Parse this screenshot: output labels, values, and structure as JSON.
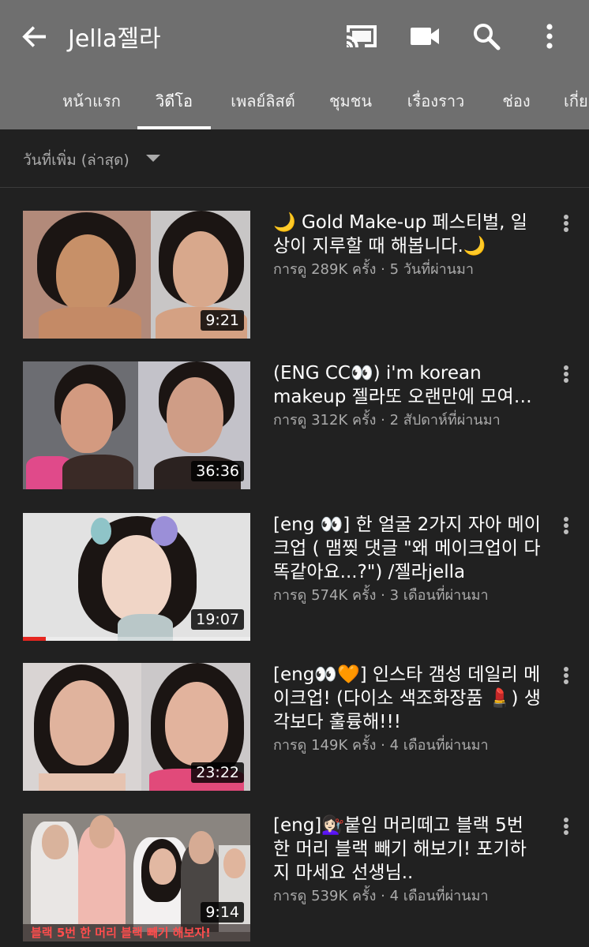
{
  "header": {
    "title": "Jella젤라",
    "icons": [
      "back-arrow-icon",
      "cast-icon",
      "video-camera-icon",
      "search-icon",
      "more-vert-icon"
    ]
  },
  "tabs": [
    {
      "label": "หน้าแรก",
      "active": false
    },
    {
      "label": "วิดีโอ",
      "active": true
    },
    {
      "label": "เพลย์ลิสต์",
      "active": false
    },
    {
      "label": "ชุมชน",
      "active": false
    },
    {
      "label": "เรื่องราว",
      "active": false
    },
    {
      "label": "ช่อง",
      "active": false
    },
    {
      "label": "เกี่ย",
      "active": false
    }
  ],
  "sort": {
    "label": "วันที่เพิ่ม (ล่าสุด)"
  },
  "videos": [
    {
      "title": "🌙 Gold Make-up 페스티벌, 일상이 지루할 때 해봅니다.🌙",
      "views": "การดู 289K ครั้ง",
      "age": "5 วันที่ผ่านมา",
      "subtitle": "การดู 289K ครั้ง · 5 วันที่ผ่านมา",
      "duration": "9:21"
    },
    {
      "title": "(ENG CC👀) i'm korean makeup 젤라또 오랜만에 모여…",
      "views": "การดู 312K ครั้ง",
      "age": "2 สัปดาห์ที่ผ่านมา",
      "subtitle": "การดู 312K ครั้ง · 2 สัปดาห์ที่ผ่านมา",
      "duration": "36:36"
    },
    {
      "title": "[eng 👀] 한 얼굴 2가지 자아 메이크업 ( 맴찢 댓글 \"왜 메이크업이 다 똑같아요...?\") /젤라jella",
      "views": "การดู 574K ครั้ง",
      "age": "3 เดือนที่ผ่านมา",
      "subtitle": "การดู 574K ครั้ง · 3 เดือนที่ผ่านมา",
      "duration": "19:07",
      "watched_fraction": 0.1
    },
    {
      "title": "[eng👀🧡] 인스타 갬성 데일리 메이크업! (다이소 색조화장품 💄) 생각보다 훌륭해!!!",
      "views": "การดู 149K ครั้ง",
      "age": "4 เดือนที่ผ่านมา",
      "subtitle": "การดู 149K ครั้ง · 4 เดือนที่ผ่านมา",
      "duration": "23:22"
    },
    {
      "title": "[eng]💇🏻‍♀️붙임 머리떼고 블랙 5번 한 머리 블랙 빼기 해보기! 포기하지 마세요 선생님..",
      "views": "การดู 539K ครั้ง",
      "age": "4 เดือนที่ผ่านมา",
      "subtitle": "การดู 539K ครั้ง · 4 เดือนที่ผ่านมา",
      "duration": "9:14",
      "thumb_caption": "블랙 5번 한 머리 블랙 빼기 해보자!"
    }
  ],
  "colors": {
    "header_bg": "#6f6f6f",
    "page_bg": "#212121",
    "progress_red": "#e52620",
    "secondary_text": "#aaaaaa"
  }
}
